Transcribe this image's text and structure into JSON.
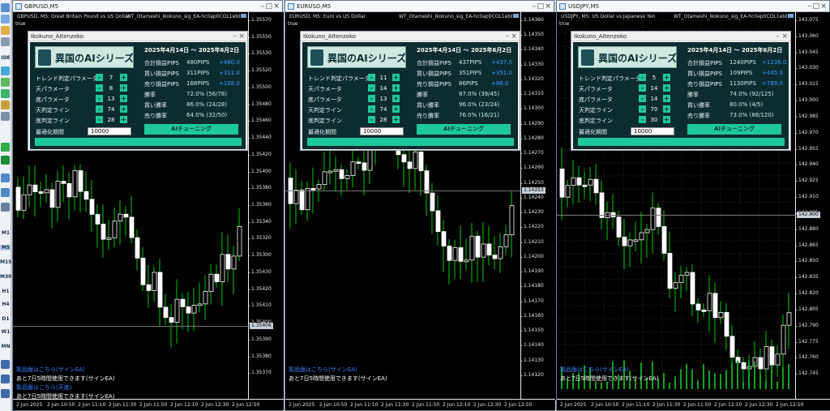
{
  "toolbar": {
    "labels": [
      "IDE",
      "M1",
      "M5",
      "M15",
      "M30",
      "H1",
      "H4",
      "D1",
      "W1",
      "MN"
    ]
  },
  "colors": {
    "bull": "#ffffff",
    "bear": "#ffffff",
    "wick": "#00c800",
    "accent": "#1ec89c",
    "panel_bg": "#0c2c30",
    "link": "#3c82ff"
  },
  "windows": [
    {
      "title": "GBPUSD,M5",
      "subtitle": "GBPUSD, M5:  Great Britain Pound vs US Dollar",
      "ea_name": "WT_Otameshi_Ikokuno_sig_EA-hc0ap0COL1ebEX",
      "true_label": "true",
      "price_ticks": [
        "1.35570",
        "1.35550",
        "1.35530",
        "1.35520",
        "1.35500",
        "1.35480",
        "1.35460",
        "1.35440",
        "1.35420",
        "1.35400",
        "1.35380",
        "1.35360",
        "1.35340",
        "1.35320",
        "1.35300"
      ],
      "price_ticks_bottom": [
        "1.35430",
        "1.35420",
        "1.35410",
        "1.35400",
        "1.35390",
        "1.35380",
        "1.35370"
      ],
      "current_price": "1.35406",
      "time_ticks": [
        "2 Jun 2025",
        "2 Jun 10:50",
        "2 Jun 11:10",
        "2 Jun 11:30",
        "2 Jun 11:50",
        "2 Jun 12:10",
        "2 Jun 12:30",
        "2 Jun 12:50"
      ],
      "notes": [
        "製品版はこちら(サインEA)",
        "あと7日5時間使用できます(サインEA)",
        "製品版はこちら(天底)",
        "あと7日5時間使用できます(サインEA)"
      ],
      "panel": {
        "title": "Ikokuno_AItenzoko",
        "logo_text": "異国のAIシリーズ",
        "params": [
          {
            "label": "トレンド判定パラメータ",
            "value": "7"
          },
          {
            "label": "天パラメータ",
            "value": "8"
          },
          {
            "label": "底パラメータ",
            "value": "13"
          },
          {
            "label": "天判定ライン",
            "value": "74"
          },
          {
            "label": "底判定ライン",
            "value": "28"
          }
        ],
        "optimize_label": "最適化期間",
        "optimize_value": "10000",
        "date_range": "2025年4月14日 ～ 2025年6月2日",
        "stats": [
          {
            "label": "合計損益PIPS",
            "v1": "480PIPS",
            "v2": "+480.0"
          },
          {
            "label": "買い損益PIPS",
            "v1": "311PIPS",
            "v2": "+311.0"
          },
          {
            "label": "売り損益PIPS",
            "v1": "168PIPS",
            "v2": "+168.0"
          },
          {
            "label": "勝率",
            "v1": "72.0% (56/78)",
            "v2": ""
          },
          {
            "label": "買い勝率",
            "v1": "86.0% (24/28)",
            "v2": ""
          },
          {
            "label": "売り勝率",
            "v1": "64.0% (32/50)",
            "v2": ""
          }
        ],
        "tune_label": "AIチューニング"
      }
    },
    {
      "title": "EURUSD,M5",
      "subtitle": "EURUSD, M5:  Euro vs US Dollar",
      "ea_name": "WT_Otameshi_Ikokuno_sig_EA-hc0ap0COL1ebEX",
      "true_label": "true",
      "price_ticks": [
        "1.14360",
        "1.14350",
        "1.14340",
        "1.14330",
        "1.14320",
        "1.14310",
        "1.14300",
        "1.14290",
        "1.14280",
        "1.14270",
        "1.14260",
        "1.14250",
        "1.14240",
        "1.14230",
        "1.14220"
      ],
      "price_ticks_bottom": [
        "1.14210",
        "1.14200",
        "1.14190",
        "1.14180",
        "1.14170",
        "1.14160",
        "1.14150",
        "1.14140",
        "1.14130",
        "1.14120"
      ],
      "current_price": "1.14253",
      "time_ticks": [
        "2 Jun 2025",
        "2 Jun 10:50",
        "2 Jun 11:10",
        "2 Jun 11:30",
        "2 Jun 11:50",
        "2 Jun 12:10",
        "2 Jun 12:30",
        "2 Jun 12:50"
      ],
      "notes": [
        "製品版はこちら(サインEA)",
        "あと7日5時間使用できます(サインEA)"
      ],
      "panel": {
        "title": "Ikokuno_AItenzoko",
        "logo_text": "異国のAIシリーズ",
        "params": [
          {
            "label": "トレンド判定パラメータ",
            "value": "11"
          },
          {
            "label": "天パラメータ",
            "value": "14"
          },
          {
            "label": "底パラメータ",
            "value": "13"
          },
          {
            "label": "天判定ライン",
            "value": "74"
          },
          {
            "label": "底判定ライン",
            "value": "28"
          }
        ],
        "optimize_label": "最適化期間",
        "optimize_value": "10000",
        "date_range": "2025年4月14日 ～ 2025年6月2日",
        "stats": [
          {
            "label": "合計損益PIPS",
            "v1": "437PIPS",
            "v2": "+437.0"
          },
          {
            "label": "買い損益PIPS",
            "v1": "351PIPS",
            "v2": "+351.0"
          },
          {
            "label": "売り損益PIPS",
            "v1": "86PIPS",
            "v2": "+86.0"
          },
          {
            "label": "勝率",
            "v1": "87.0% (39/45)",
            "v2": ""
          },
          {
            "label": "買い勝率",
            "v1": "96.0% (23/24)",
            "v2": ""
          },
          {
            "label": "売り勝率",
            "v1": "76.0% (16/21)",
            "v2": ""
          }
        ],
        "tune_label": "AIチューニング"
      }
    },
    {
      "title": "USDJPY,M5",
      "subtitle": "USDJPY, M5:  US Dollar vs Japanese Yen",
      "ea_name": "WT_Otameshi_Ikokuno_sig_EA-hc0ap0COL1ebEX",
      "true_label": "true",
      "price_ticks": [
        "143.075",
        "143.060",
        "143.045",
        "143.030",
        "143.015",
        "143.000",
        "142.985",
        "142.970",
        "142.955",
        "142.940",
        "142.925",
        "142.910",
        "142.895",
        "142.880",
        "142.865"
      ],
      "price_ticks_bottom": [
        "142.850",
        "142.835",
        "142.820",
        "142.805",
        "142.790",
        "142.775",
        "142.760",
        "142.745"
      ],
      "current_price": "142.900",
      "time_ticks": [
        "2 Jun 2025",
        "2 Jun 10:50",
        "2 Jun 11:10",
        "2 Jun 11:30",
        "2 Jun 11:50",
        "2 Jun 12:10",
        "2 Jun 12:30",
        "2 Jun 12:50"
      ],
      "notes": [
        "製品版はこちら(サインEA)",
        "あと7日5時間使用できます(サインEA)"
      ],
      "panel": {
        "title": "Ikokuno_AItenzoko",
        "logo_text": "異国のAIシリーズ",
        "params": [
          {
            "label": "トレンド判定パラメータ",
            "value": "5"
          },
          {
            "label": "天パラメータ",
            "value": "14"
          },
          {
            "label": "底パラメータ",
            "value": "14"
          },
          {
            "label": "天判定ライン",
            "value": "70"
          },
          {
            "label": "底判定ライン",
            "value": "30"
          }
        ],
        "optimize_label": "最適化期間",
        "optimize_value": "10000",
        "date_range": "2025年4月14日 ～ 2025年6月2日",
        "stats": [
          {
            "label": "合計損益PIPS",
            "v1": "1240PIPS",
            "v2": "+1236.0"
          },
          {
            "label": "買い損益PIPS",
            "v1": "109PIPS",
            "v2": "+445.0"
          },
          {
            "label": "売り損益PIPS",
            "v1": "1130PIPS",
            "v2": "+789.0"
          },
          {
            "label": "勝率",
            "v1": "74.0% (92/125)",
            "v2": ""
          },
          {
            "label": "買い勝率",
            "v1": "80.0% (4/5)",
            "v2": ""
          },
          {
            "label": "売り勝率",
            "v1": "73.0% (88/120)",
            "v2": ""
          }
        ],
        "tune_label": "AIチューニング"
      }
    }
  ]
}
